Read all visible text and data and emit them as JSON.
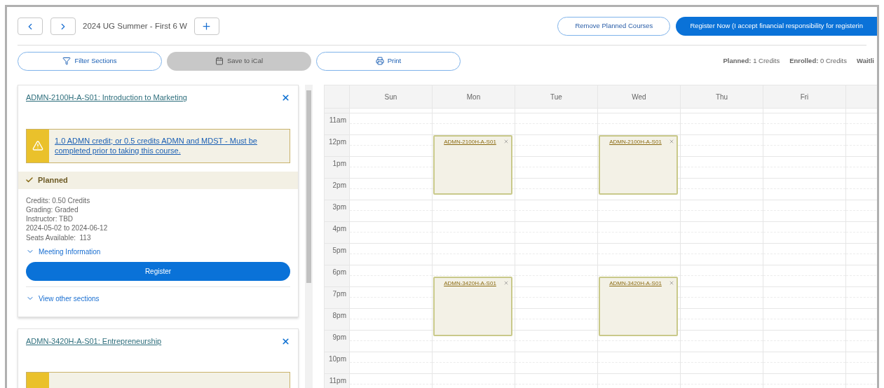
{
  "term_nav": {
    "term": "2024 UG Summer - First 6 W"
  },
  "header_buttons": [
    {
      "label": "Remove Planned Courses",
      "kind": "outline"
    },
    {
      "label": "Register Now (I accept financial responsibility for registerin",
      "kind": "primary"
    }
  ],
  "toolbar": [
    {
      "label": "Filter Sections",
      "kind": "filter",
      "disabled": false
    },
    {
      "label": "Save to iCal",
      "kind": "calendar",
      "disabled": true
    },
    {
      "label": "Print",
      "kind": "print",
      "disabled": false
    }
  ],
  "credits": [
    "**Planned:** 1 Credits",
    "**Enrolled:** 0 Credits",
    "**Waitli**"
  ],
  "courses": [
    {
      "kind": "expanded",
      "title": "ADMN-2100H-A-S01: Introduction to Marketing",
      "warning": "1.0 ADMN credit; or 0.5 credits ADMN and MDST - Must be completed prior to taking this course.",
      "status": "Planned",
      "details": [
        "Credits: 0.50 Credits",
        "Grading: Graded",
        "Instructor: TBD",
        "2024-05-02 to 2024-06-12",
        "Seats Available:  113"
      ],
      "meeting_label": "Meeting Information",
      "register_label": "Register",
      "other_sections_label": "View other sections"
    },
    {
      "kind": "cut",
      "title": "ADMN-3420H-A-S01: Entrepreneurship"
    }
  ],
  "calendar": {
    "days": [
      {
        "label": "Sun"
      },
      {
        "label": "Mon",
        "events": [
          {
            "code": "ADMN-2100H-A-S01",
            "kind": "afternoon"
          },
          {
            "code": "ADMN-3420H-A-S01",
            "kind": "evening"
          }
        ]
      },
      {
        "label": "Tue"
      },
      {
        "label": "Wed",
        "events": [
          {
            "code": "ADMN-2100H-A-S01",
            "kind": "afternoon"
          },
          {
            "code": "ADMN-3420H-A-S01",
            "kind": "evening"
          }
        ]
      },
      {
        "label": "Thu"
      },
      {
        "label": "Fri"
      }
    ],
    "hours": [
      "11am",
      "12pm",
      "1pm",
      "2pm",
      "3pm",
      "4pm",
      "5pm",
      "6pm",
      "7pm",
      "8pm",
      "9pm",
      "10pm",
      "11pm"
    ]
  }
}
